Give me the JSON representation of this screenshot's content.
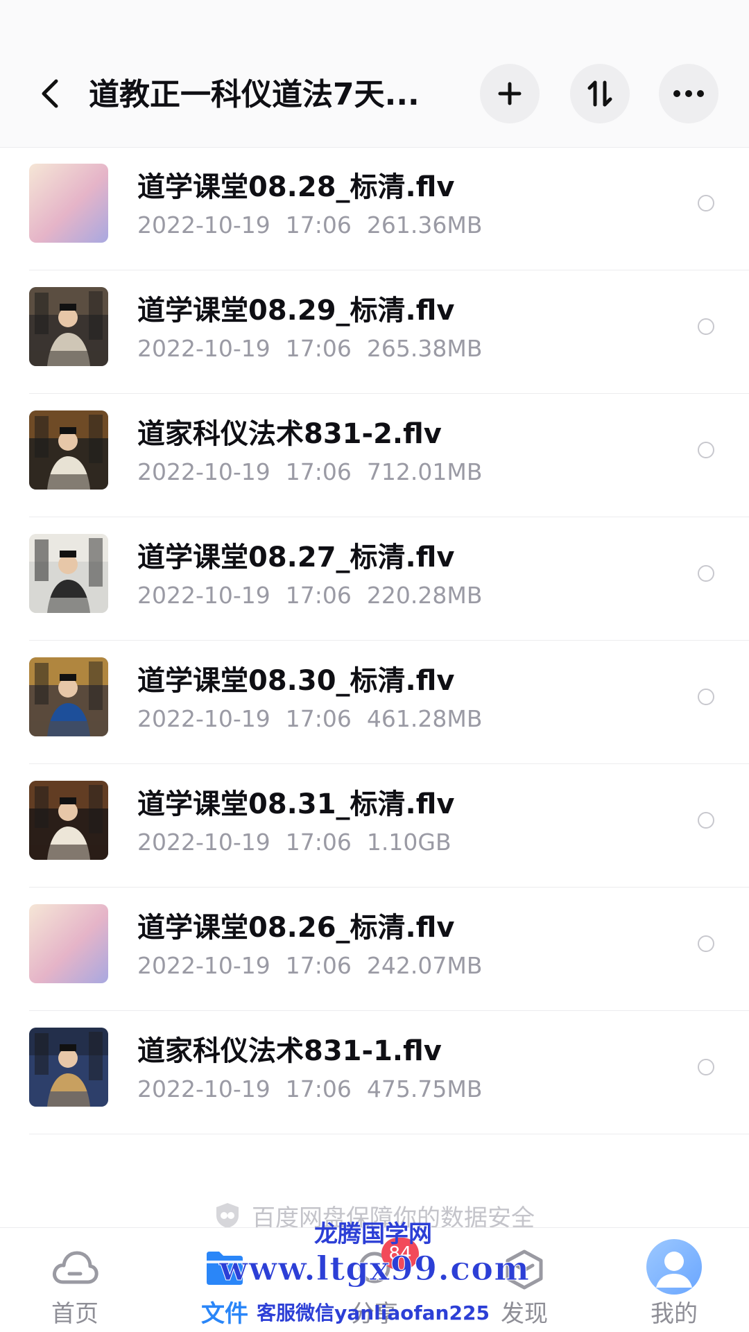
{
  "header": {
    "title": "道教正一科仪道法7天..."
  },
  "files": [
    {
      "name": "道学课堂08.28_标清.flv",
      "date": "2022-10-19",
      "time": "17:06",
      "size": "261.36MB",
      "thumb": "gradient"
    },
    {
      "name": "道学课堂08.29_标清.flv",
      "date": "2022-10-19",
      "time": "17:06",
      "size": "265.38MB",
      "thumb": "video"
    },
    {
      "name": "道家科仪法术831-2.flv",
      "date": "2022-10-19",
      "time": "17:06",
      "size": "712.01MB",
      "thumb": "video"
    },
    {
      "name": "道学课堂08.27_标清.flv",
      "date": "2022-10-19",
      "time": "17:06",
      "size": "220.28MB",
      "thumb": "video"
    },
    {
      "name": "道学课堂08.30_标清.flv",
      "date": "2022-10-19",
      "time": "17:06",
      "size": "461.28MB",
      "thumb": "video"
    },
    {
      "name": "道学课堂08.31_标清.flv",
      "date": "2022-10-19",
      "time": "17:06",
      "size": "1.10GB",
      "thumb": "video"
    },
    {
      "name": "道学课堂08.26_标清.flv",
      "date": "2022-10-19",
      "time": "17:06",
      "size": "242.07MB",
      "thumb": "gradient"
    },
    {
      "name": "道家科仪法术831-1.flv",
      "date": "2022-10-19",
      "time": "17:06",
      "size": "475.75MB",
      "thumb": "video"
    }
  ],
  "security_note": "百度网盘保障你的数据安全",
  "nav": {
    "home": "首页",
    "files": "文件",
    "share": "分享",
    "share_badge": "84",
    "discover": "发现",
    "mine": "我的"
  },
  "watermark": {
    "title": "龙腾国学网",
    "url": "www.ltgx99.com",
    "contact": "客服微信yanliaofan225"
  },
  "colors": {
    "accent": "#2a86f8",
    "badge": "#f24a5a",
    "watermark": "#2c3fd6"
  }
}
